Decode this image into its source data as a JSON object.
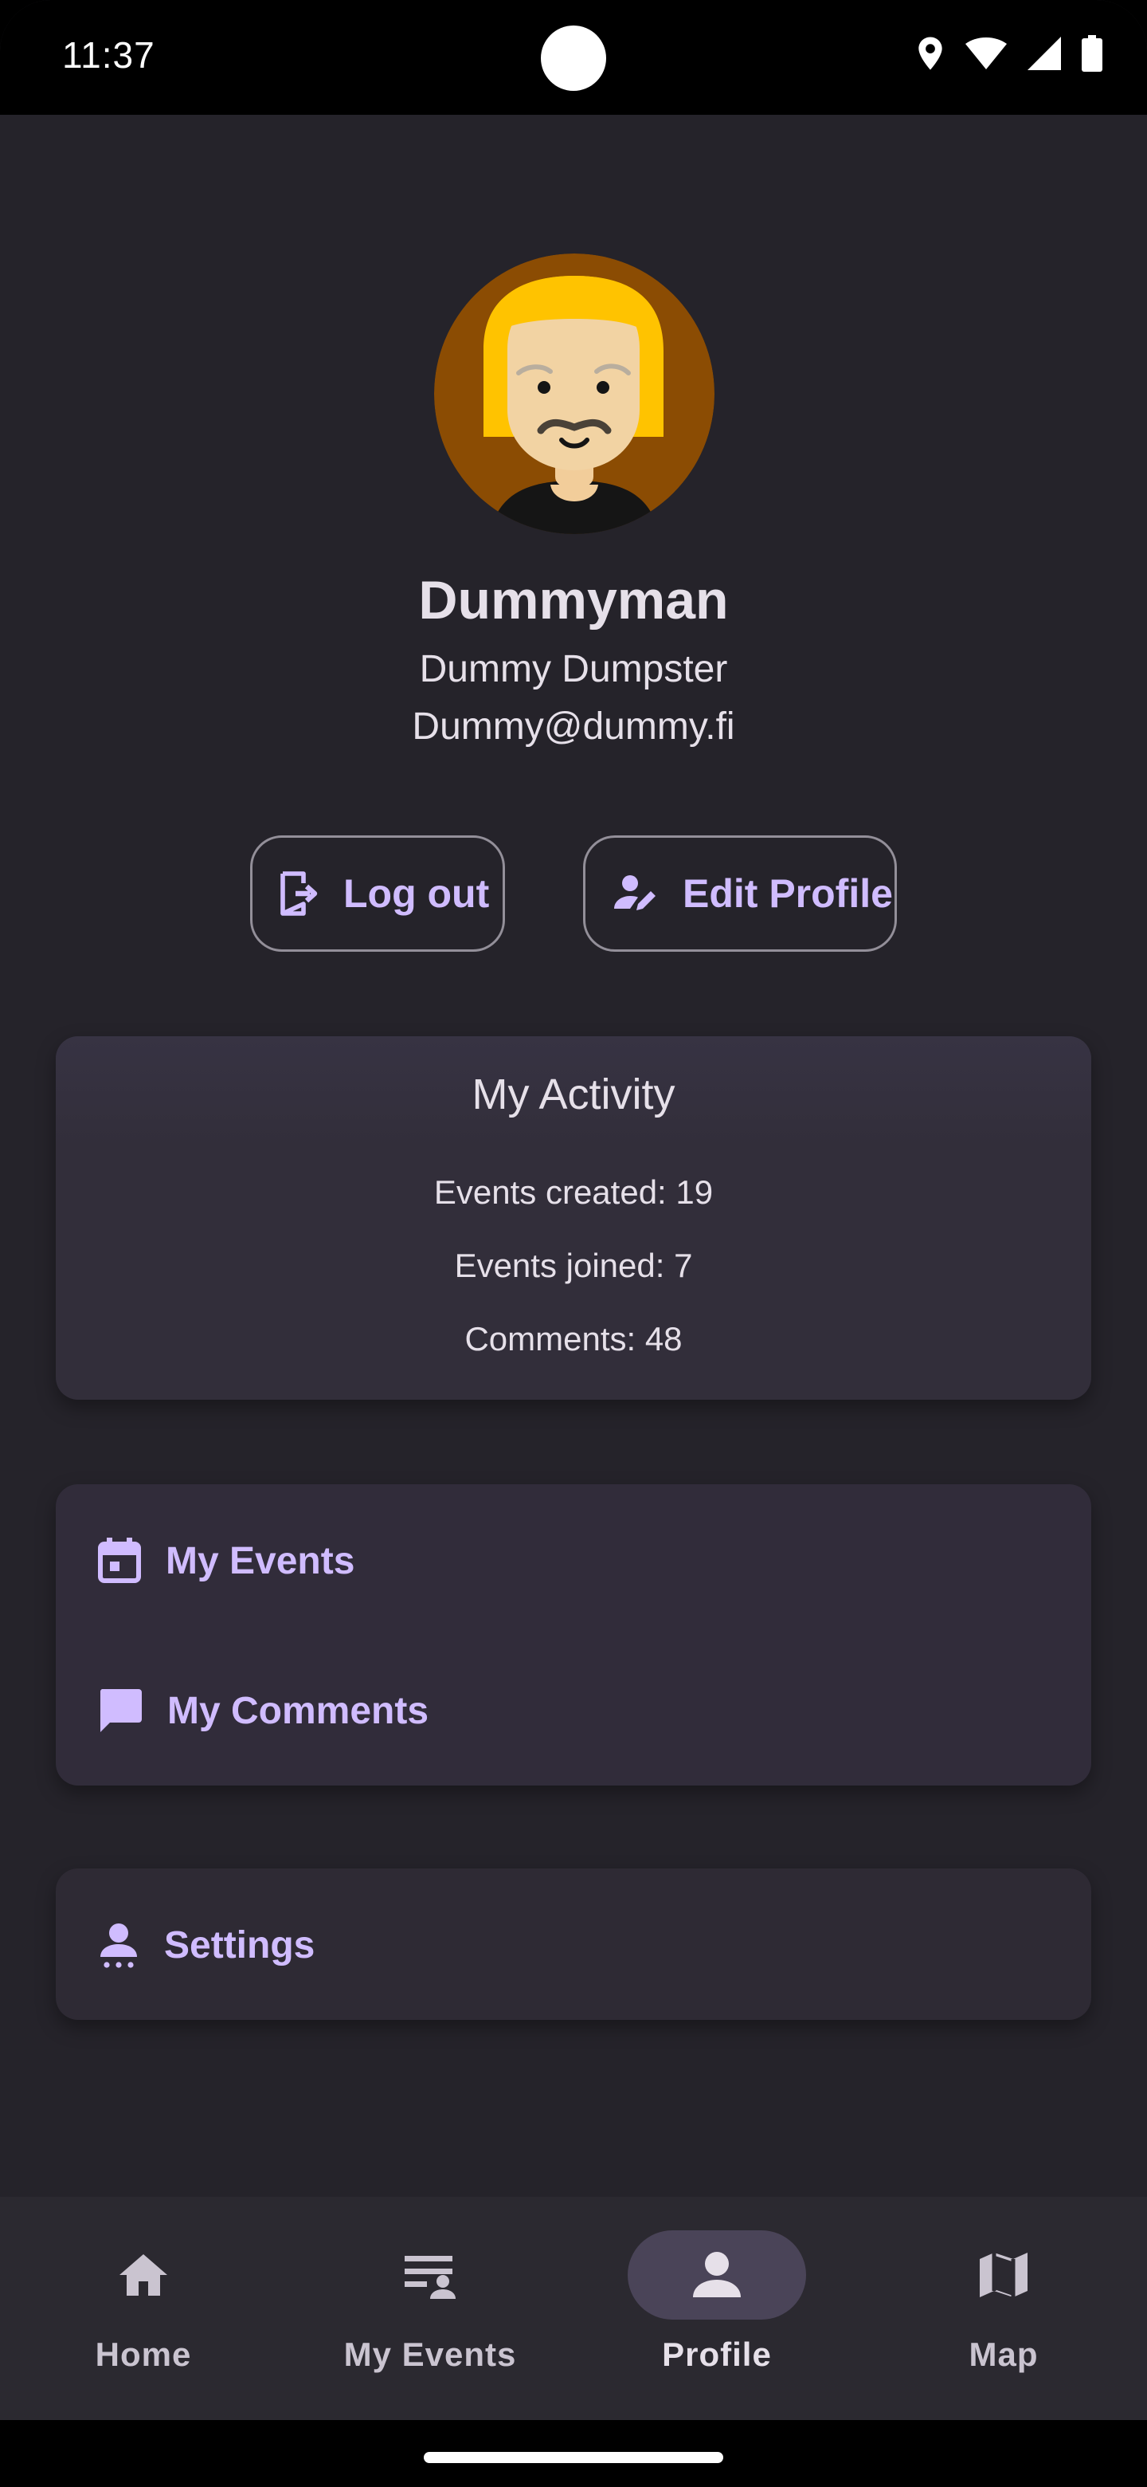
{
  "status_bar": {
    "time": "11:37",
    "icons": [
      "location-icon",
      "wifi-icon",
      "signal-icon",
      "battery-icon"
    ]
  },
  "profile": {
    "username": "Dummyman",
    "full_name": "Dummy Dumpster",
    "email": "Dummy@dummy.fi"
  },
  "actions": {
    "logout_label": "Log out",
    "edit_profile_label": "Edit Profile"
  },
  "activity": {
    "title": "My Activity",
    "stats": [
      "Events created: 19",
      "Events joined: 7",
      "Comments: 48"
    ]
  },
  "links": {
    "my_events": "My Events",
    "my_comments": "My Comments",
    "settings": "Settings"
  },
  "bottom_nav": {
    "items": [
      {
        "label": "Home",
        "icon": "home-icon"
      },
      {
        "label": "My Events",
        "icon": "event-list-icon"
      },
      {
        "label": "Profile",
        "icon": "person-icon",
        "active": true
      },
      {
        "label": "Map",
        "icon": "map-icon"
      }
    ]
  },
  "colors": {
    "background": "#25232A",
    "accent": "#D0BCFF",
    "text": "#E6E0E9",
    "card": "#322E3A",
    "nav_indicator": "#4A4458"
  }
}
